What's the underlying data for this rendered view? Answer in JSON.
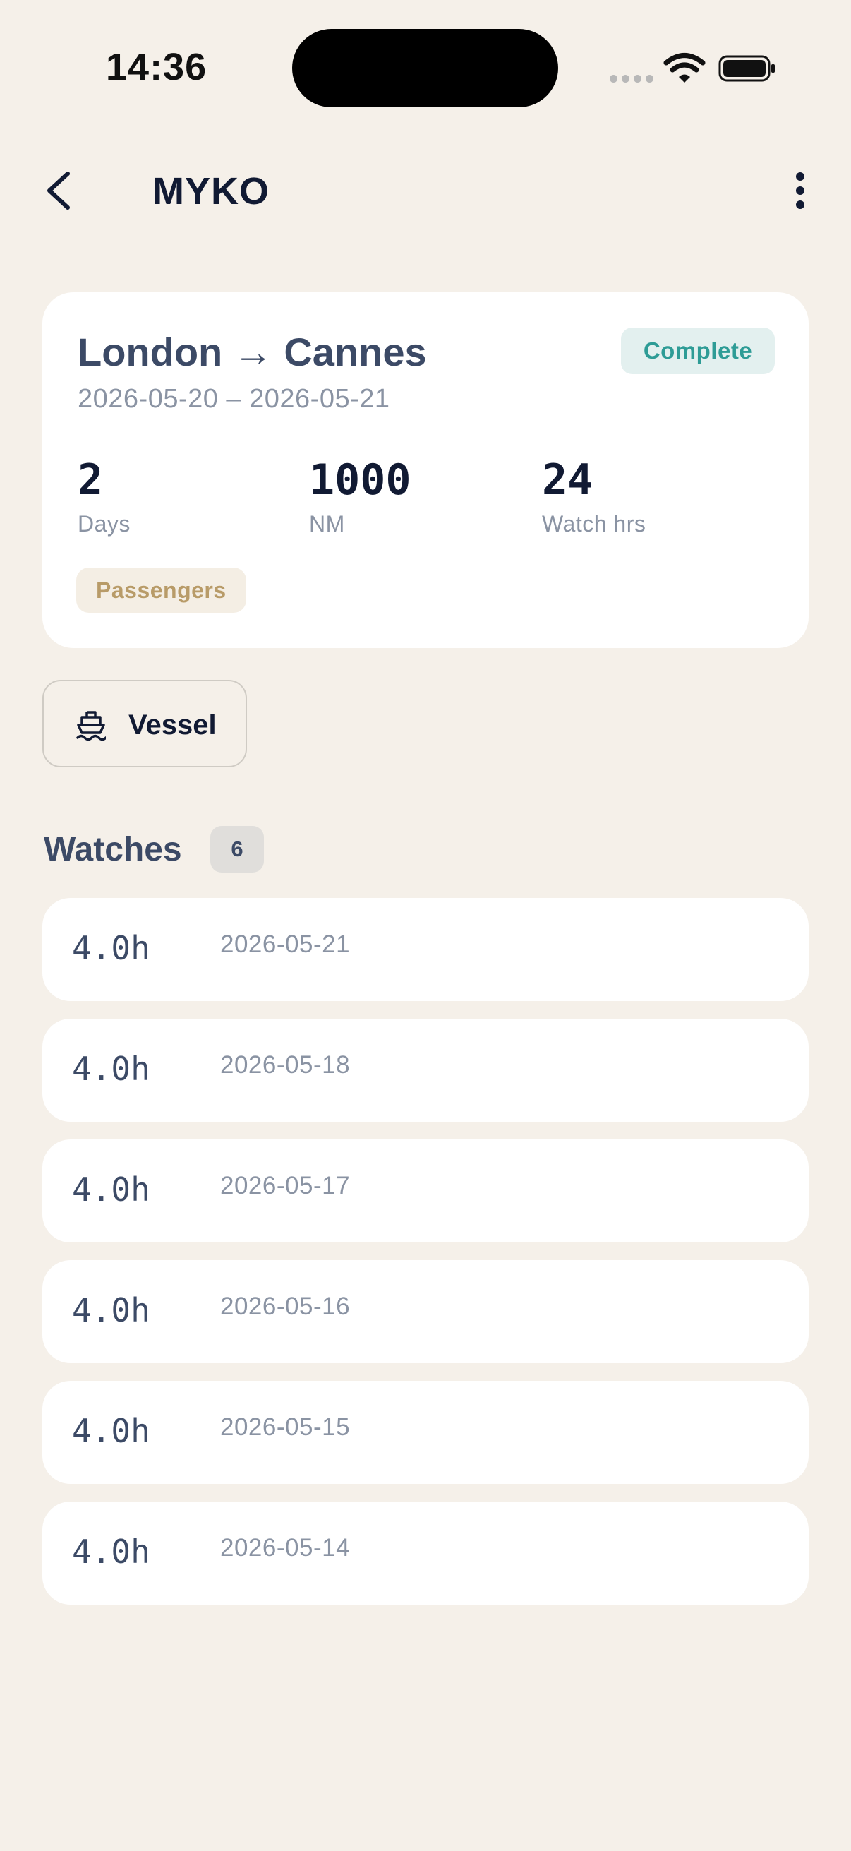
{
  "status_bar": {
    "time": "14:36"
  },
  "nav": {
    "title": "MYKO"
  },
  "trip": {
    "title": "London → Cannes",
    "dates": "2026-05-20 – 2026-05-21",
    "status": "Complete",
    "stats": [
      {
        "value": "2",
        "label": "Days"
      },
      {
        "value": "1000",
        "label": "NM"
      },
      {
        "value": "24",
        "label": "Watch hrs"
      }
    ],
    "tag": "Passengers"
  },
  "vessel_button": {
    "label": "Vessel",
    "icon": "ship-icon"
  },
  "watches": {
    "title": "Watches",
    "count": "6",
    "items": [
      {
        "hours": "4.0h",
        "date": "2026-05-21"
      },
      {
        "hours": "4.0h",
        "date": "2026-05-18"
      },
      {
        "hours": "4.0h",
        "date": "2026-05-17"
      },
      {
        "hours": "4.0h",
        "date": "2026-05-16"
      },
      {
        "hours": "4.0h",
        "date": "2026-05-15"
      },
      {
        "hours": "4.0h",
        "date": "2026-05-14"
      }
    ]
  },
  "colors": {
    "background": "#F5F0E9",
    "card": "#FFFFFF",
    "status_complete_text": "#2E9C96",
    "status_complete_bg": "#E3F0EF",
    "tag_text": "#B89B68",
    "tag_bg": "#F4EEE4",
    "muted_text": "#8A93A3",
    "primary_text": "#111A33"
  }
}
